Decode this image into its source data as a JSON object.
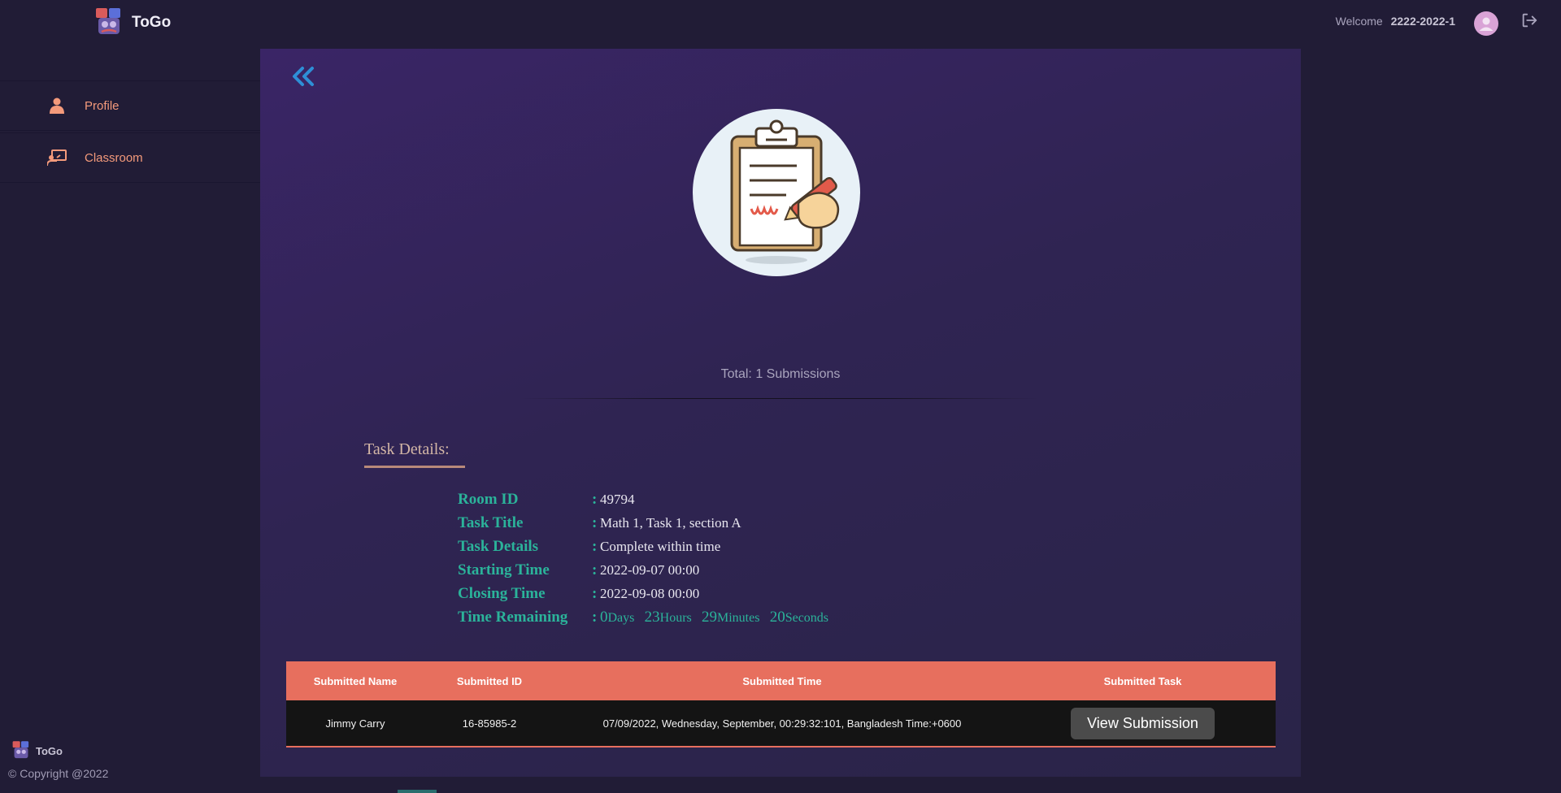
{
  "header": {
    "brand_name": "ToGo",
    "welcome_label": "Welcome",
    "username": "2222-2022-1"
  },
  "sidebar": {
    "items": [
      {
        "label": "Profile",
        "icon": "user-icon"
      },
      {
        "label": "Classroom",
        "icon": "classroom-icon"
      }
    ]
  },
  "footer": {
    "brand_name": "ToGo",
    "copyright": "© Copyright @2022"
  },
  "main": {
    "total_submissions": "Total: 1 Submissions",
    "task_heading": "Task Details:",
    "details": [
      {
        "label": "Room ID",
        "value": "49794"
      },
      {
        "label": "Task Title",
        "value": "Math 1, Task 1, section A"
      },
      {
        "label": "Task Details",
        "value": "Complete within time"
      },
      {
        "label": "Starting Time",
        "value": "2022-09-07 00:00"
      },
      {
        "label": "Closing Time",
        "value": "2022-09-08 00:00"
      }
    ],
    "time_remaining": {
      "label": "Time Remaining",
      "days": "0",
      "days_unit": "Days",
      "hours": "23",
      "hours_unit": "Hours",
      "minutes": "29",
      "minutes_unit": "Minutes",
      "seconds": "20",
      "seconds_unit": "Seconds"
    },
    "table": {
      "headers": [
        "Submitted Name",
        "Submitted ID",
        "Submitted Time",
        "Submitted Task"
      ],
      "rows": [
        {
          "name": "Jimmy Carry",
          "id": "16-85985-2",
          "time": "07/09/2022, Wednesday, September, 00:29:32:101, Bangladesh Time:+0600",
          "action": "View Submission"
        }
      ]
    }
  },
  "colors": {
    "accent": "#e76f5e",
    "label_teal": "#2bb39a",
    "sidebar_text": "#f49a7b",
    "back_arrow": "#2e8fd6"
  }
}
